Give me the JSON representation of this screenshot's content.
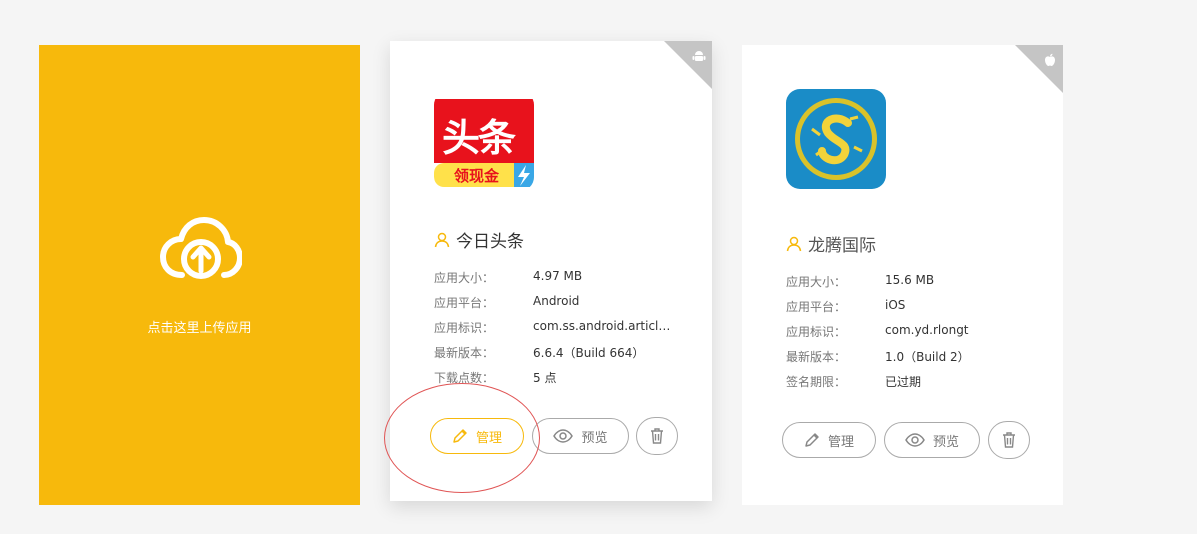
{
  "upload": {
    "label": "点击这里上传应用"
  },
  "apps": [
    {
      "platform_icon": "android-icon",
      "icon_text_main": "头条",
      "icon_text_sub": "领现金",
      "name": "今日头条",
      "fields": [
        {
          "label": "应用大小：",
          "value": "4.97 MB"
        },
        {
          "label": "应用平台：",
          "value": "Android"
        },
        {
          "label": "应用标识：",
          "value": "com.ss.android.article..."
        },
        {
          "label": "最新版本：",
          "value": "6.6.4（Build 664）"
        },
        {
          "label": "下载点数：",
          "value": "5 点"
        }
      ],
      "buttons": {
        "manage": "管理",
        "preview": "预览"
      }
    },
    {
      "platform_icon": "apple-icon",
      "name": "龙腾国际",
      "fields": [
        {
          "label": "应用大小：",
          "value": "15.6 MB"
        },
        {
          "label": "应用平台：",
          "value": "iOS"
        },
        {
          "label": "应用标识：",
          "value": "com.yd.rlongt"
        },
        {
          "label": "最新版本：",
          "value": "1.0（Build 2）"
        },
        {
          "label": "签名期限：",
          "value": "已过期"
        }
      ],
      "buttons": {
        "manage": "管理",
        "preview": "预览"
      }
    }
  ],
  "colors": {
    "accent": "#f7b90c",
    "annotation": "#e05555",
    "corner": "#c5c5c5"
  }
}
